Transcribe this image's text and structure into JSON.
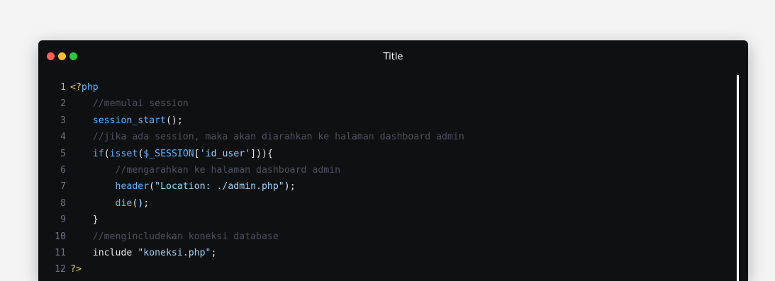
{
  "window": {
    "title": "Title",
    "traffic_lights": [
      {
        "name": "close",
        "color": "#fe5f57"
      },
      {
        "name": "minimize",
        "color": "#febc2e"
      },
      {
        "name": "maximize",
        "color": "#28c840"
      }
    ]
  },
  "colors": {
    "background": "#0f1011",
    "keyword": "#61b5ff",
    "string": "#9ad6ff",
    "comment": "#4b5160",
    "php_tag": "#e3d36a",
    "plain": "#e4e6ea",
    "line_number": "#6c7281"
  },
  "code": {
    "lines": [
      {
        "n": "1",
        "tokens": [
          {
            "t": "<?",
            "c": "tag"
          },
          {
            "t": "php",
            "c": "kw"
          }
        ]
      },
      {
        "n": "2",
        "tokens": [
          {
            "t": "    //memulai session",
            "c": "cmt"
          }
        ]
      },
      {
        "n": "3",
        "tokens": [
          {
            "t": "    ",
            "c": "plain"
          },
          {
            "t": "session_start",
            "c": "fn"
          },
          {
            "t": "();",
            "c": "plain"
          }
        ]
      },
      {
        "n": "4",
        "tokens": [
          {
            "t": "    //jika ada session, maka akan diarahkan ke halaman dashboard admin",
            "c": "cmt"
          }
        ]
      },
      {
        "n": "5",
        "tokens": [
          {
            "t": "    ",
            "c": "plain"
          },
          {
            "t": "if",
            "c": "kw"
          },
          {
            "t": "(",
            "c": "plain"
          },
          {
            "t": "isset",
            "c": "fn"
          },
          {
            "t": "(",
            "c": "plain"
          },
          {
            "t": "$_SESSION",
            "c": "var"
          },
          {
            "t": "[",
            "c": "plain"
          },
          {
            "t": "'id_user'",
            "c": "str"
          },
          {
            "t": "])){",
            "c": "plain"
          }
        ]
      },
      {
        "n": "6",
        "tokens": [
          {
            "t": "        //mengarahkan ke halaman dashboard admin",
            "c": "cmt"
          }
        ]
      },
      {
        "n": "7",
        "tokens": [
          {
            "t": "        ",
            "c": "plain"
          },
          {
            "t": "header",
            "c": "fn"
          },
          {
            "t": "(",
            "c": "plain"
          },
          {
            "t": "\"Location: ./admin.php\"",
            "c": "str"
          },
          {
            "t": ");",
            "c": "plain"
          }
        ]
      },
      {
        "n": "8",
        "tokens": [
          {
            "t": "        ",
            "c": "plain"
          },
          {
            "t": "die",
            "c": "fn"
          },
          {
            "t": "();",
            "c": "plain"
          }
        ]
      },
      {
        "n": "9",
        "tokens": [
          {
            "t": "    }",
            "c": "plain"
          }
        ]
      },
      {
        "n": "10",
        "tokens": [
          {
            "t": "    //mengincludekan koneksi database",
            "c": "cmt"
          }
        ]
      },
      {
        "n": "11",
        "tokens": [
          {
            "t": "    include ",
            "c": "plain"
          },
          {
            "t": "\"koneksi.php\"",
            "c": "str"
          },
          {
            "t": ";",
            "c": "plain"
          }
        ]
      },
      {
        "n": "12",
        "tokens": [
          {
            "t": "?>",
            "c": "tag"
          }
        ]
      }
    ]
  }
}
